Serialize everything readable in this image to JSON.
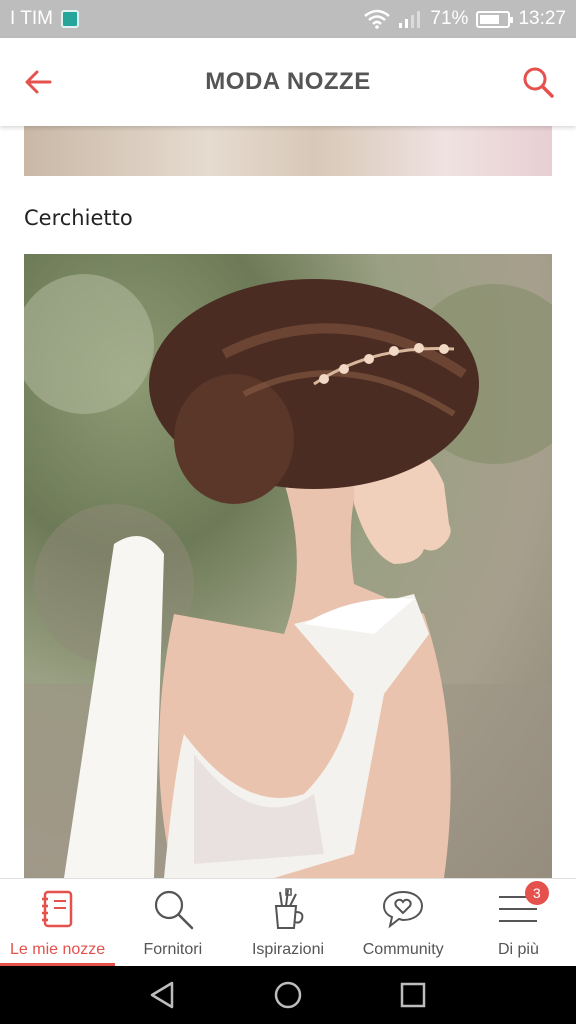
{
  "status_bar": {
    "carrier": "I TIM",
    "battery": "71%",
    "time": "13:27"
  },
  "app_bar": {
    "title": "MODA NOZZE",
    "back_icon": "arrow-left-icon",
    "search_icon": "search-icon"
  },
  "content": {
    "section_title": "Cerchietto"
  },
  "bottom_nav": {
    "items": [
      {
        "label": "Le mie nozze",
        "icon": "notebook-icon",
        "active": true
      },
      {
        "label": "Fornitori",
        "icon": "search-icon",
        "active": false
      },
      {
        "label": "Ispirazioni",
        "icon": "tools-cup-icon",
        "active": false
      },
      {
        "label": "Community",
        "icon": "chat-heart-icon",
        "active": false
      },
      {
        "label": "Di più",
        "icon": "menu-icon",
        "active": false,
        "badge": "3"
      }
    ]
  },
  "colors": {
    "accent": "#e5514d",
    "text": "#555555",
    "status_bar": "#bdbdbd"
  }
}
